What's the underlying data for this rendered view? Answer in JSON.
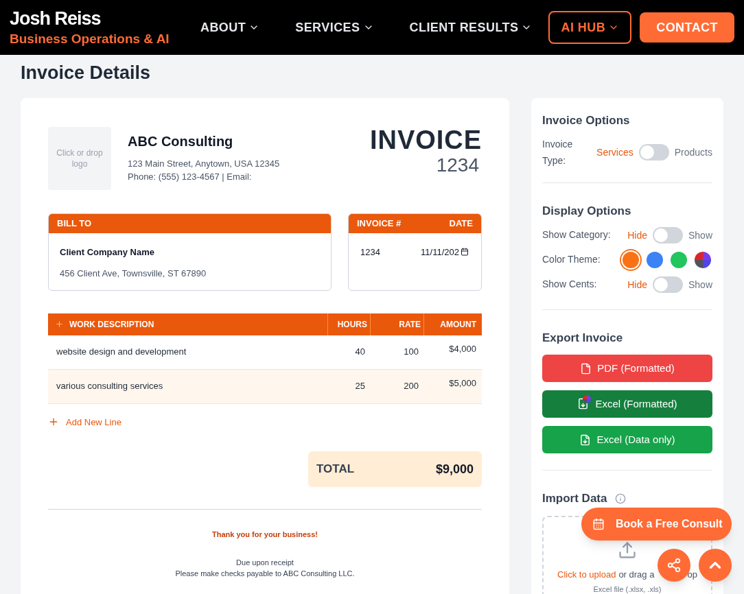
{
  "nav": {
    "brand": "Josh Reiss",
    "tagline": "Business Operations & AI",
    "items": [
      {
        "label": "ABOUT",
        "kind": "menu"
      },
      {
        "label": "SERVICES",
        "kind": "menu"
      },
      {
        "label": "CLIENT RESULTS",
        "kind": "menu"
      },
      {
        "label": "AI HUB",
        "kind": "outlined"
      },
      {
        "label": "CONTACT",
        "kind": "cta"
      }
    ]
  },
  "page_title": "Invoice Details",
  "invoice": {
    "logo_placeholder": "Click or drop logo",
    "company": "ABC Consulting",
    "address": "123 Main Street, Anytown, USA 12345",
    "contact": "Phone: (555) 123-4567 | Email:",
    "heading": "INVOICE",
    "number": "1234",
    "bill_to": {
      "label": "BILL TO",
      "name": "Client Company Name",
      "address": "456 Client Ave, Townsville, ST 67890"
    },
    "meta": {
      "number_label": "INVOICE #",
      "date_label": "DATE",
      "number": "1234",
      "date": "11/11/202"
    },
    "columns": [
      "WORK DESCRIPTION",
      "HOURS",
      "RATE",
      "AMOUNT"
    ],
    "rows": [
      {
        "description": "website design and development",
        "hours": "40",
        "rate": "100",
        "amount": "$4,000"
      },
      {
        "description": "various consulting services",
        "hours": "25",
        "rate": "200",
        "amount": "$5,000"
      }
    ],
    "add_line": "Add New Line",
    "total_label": "TOTAL",
    "total": "$9,000",
    "thanks": "Thank you for your business!",
    "terms": "Due upon receipt",
    "payable": "Please make checks payable to ABC Consulting LLC."
  },
  "sidebar": {
    "invoice_options": {
      "title": "Invoice Options",
      "toggle": {
        "label": "Invoice Type:",
        "left": "Services",
        "right": "Products",
        "on": false
      }
    },
    "display_options": {
      "title": "Display Options",
      "rows": [
        {
          "kind": "toggle",
          "label": "Show Category:",
          "left": "Hide",
          "right": "Show",
          "on": false
        },
        {
          "kind": "colors",
          "label": "Color Theme:",
          "swatches": [
            {
              "kind": "solid",
              "color": "#f97316",
              "selected": true
            },
            {
              "kind": "solid",
              "color": "#3b82f6",
              "selected": false
            },
            {
              "kind": "solid",
              "color": "#22c55e",
              "selected": false
            },
            {
              "kind": "multi",
              "selected": false
            }
          ]
        },
        {
          "kind": "toggle",
          "label": "Show Cents:",
          "left": "Hide",
          "right": "Show",
          "on": false
        }
      ]
    },
    "export": {
      "title": "Export Invoice",
      "buttons": [
        {
          "label": "PDF (Formatted)",
          "kind": "pdf"
        },
        {
          "label": "Excel (Formatted)",
          "kind": "excel_formatted"
        },
        {
          "label": "Excel (Data only)",
          "kind": "excel_data"
        }
      ]
    },
    "import": {
      "title": "Import Data",
      "link": "Click to upload",
      "text": "or drag a",
      "text_tail": "op",
      "formats": "Excel file (.xlsx, .xls)"
    }
  },
  "floating": {
    "consult": "Book a Free Consult"
  }
}
